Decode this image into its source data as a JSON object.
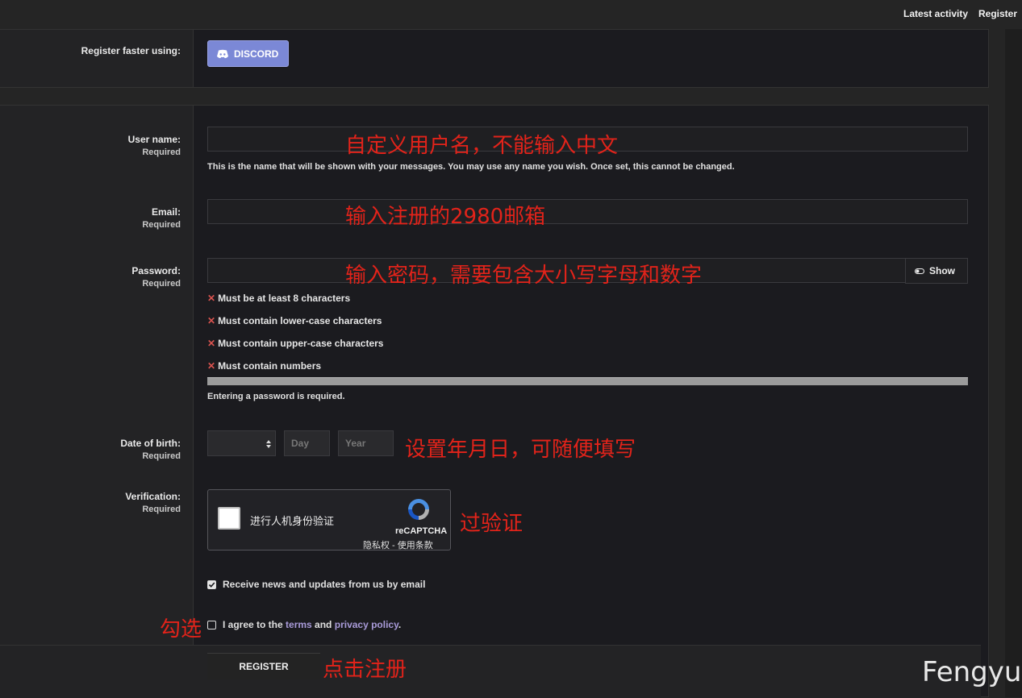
{
  "nav": {
    "latest_activity": "Latest activity",
    "register": "Register"
  },
  "social": {
    "label": "Register faster using:",
    "discord_label": "DISCORD"
  },
  "form": {
    "username": {
      "label": "User name:",
      "required": "Required",
      "value": "",
      "hint": "This is the name that will be shown with your messages. You may use any name you wish. Once set, this cannot be changed."
    },
    "email": {
      "label": "Email:",
      "required": "Required",
      "value": ""
    },
    "password": {
      "label": "Password:",
      "required": "Required",
      "value": "",
      "show_label": "Show",
      "rules": [
        "Must be at least 8 characters",
        "Must contain lower-case characters",
        "Must contain upper-case characters",
        "Must contain numbers"
      ],
      "rule_mark": "✕",
      "strength": 0,
      "status": "Entering a password is required."
    },
    "dob": {
      "label": "Date of birth:",
      "required": "Required",
      "month_value": "",
      "day_placeholder": "Day",
      "year_placeholder": "Year"
    },
    "verification": {
      "label": "Verification:",
      "required": "Required",
      "checkbox_label": "进行人机身份验证",
      "brand": "reCAPTCHA",
      "privacy": "隐私权",
      "separator": " - ",
      "terms": "使用条款"
    },
    "news": {
      "label": "Receive news and updates from us by email",
      "checked": true
    },
    "agree": {
      "prefix": "I agree to the ",
      "terms": "terms",
      "and": " and ",
      "privacy": "privacy policy",
      "suffix": ".",
      "checked": false
    },
    "register_button": "REGISTER"
  },
  "annotations": {
    "username": "自定义用户名，不能输入中文",
    "email": "输入注册的2980邮箱",
    "password": "输入密码，需要包含大小写字母和数字",
    "dob": "设置年月日，可随便填写",
    "verify": "过验证",
    "check": "勾选",
    "register": "点击注册"
  },
  "watermark": "Fengyu",
  "colors": {
    "accent_link": "#a99bd9",
    "discord": "#7b88d6",
    "annotation": "#e2231a",
    "error_mark": "#d9534f"
  }
}
